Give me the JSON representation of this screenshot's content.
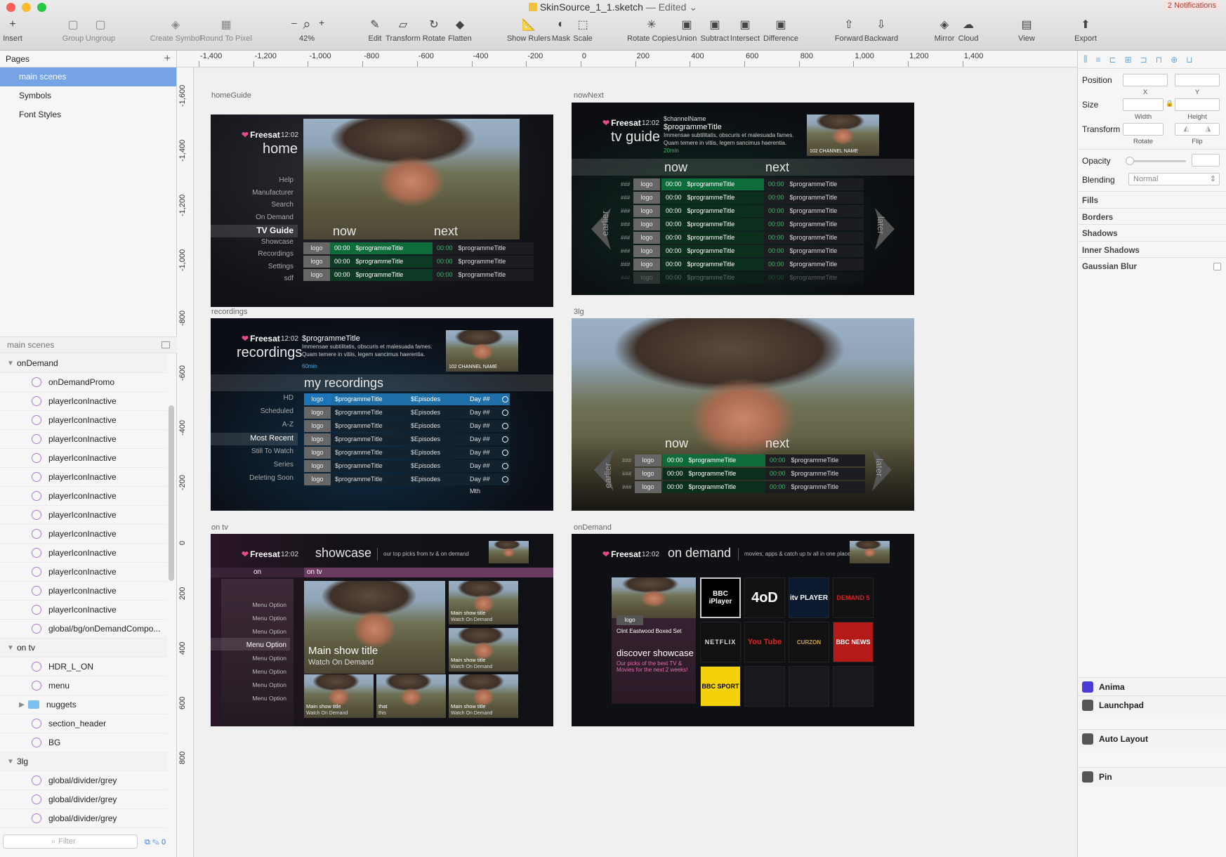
{
  "window": {
    "filename": "SkinSource_1_1.sketch",
    "status": "— Edited",
    "notifications": "2 Notifications"
  },
  "toolbar": [
    {
      "label": "Insert",
      "icon": "plus-icon"
    },
    {
      "label": "Group",
      "icon": "group-icon"
    },
    {
      "label": "Ungroup",
      "icon": "ungroup-icon"
    },
    {
      "label": "Create Symbol",
      "icon": "symbol-icon"
    },
    {
      "label": "Round To Pixel",
      "icon": "grid-icon"
    },
    {
      "label": "42%",
      "icon": "zoom-icon"
    },
    {
      "label": "Edit",
      "icon": "edit-icon"
    },
    {
      "label": "Transform",
      "icon": "transform-icon"
    },
    {
      "label": "Rotate",
      "icon": "rotate-icon"
    },
    {
      "label": "Flatten",
      "icon": "flatten-icon"
    },
    {
      "label": "Show Rulers",
      "icon": "ruler-icon"
    },
    {
      "label": "Mask",
      "icon": "mask-icon"
    },
    {
      "label": "Scale",
      "icon": "scale-icon"
    },
    {
      "label": "Rotate Copies",
      "icon": "rotate-copies-icon"
    },
    {
      "label": "Union",
      "icon": "union-icon"
    },
    {
      "label": "Subtract",
      "icon": "subtract-icon"
    },
    {
      "label": "Intersect",
      "icon": "intersect-icon"
    },
    {
      "label": "Difference",
      "icon": "difference-icon"
    },
    {
      "label": "Forward",
      "icon": "forward-icon"
    },
    {
      "label": "Backward",
      "icon": "backward-icon"
    },
    {
      "label": "Mirror",
      "icon": "mirror-icon"
    },
    {
      "label": "Cloud",
      "icon": "cloud-icon"
    },
    {
      "label": "View",
      "icon": "view-icon"
    },
    {
      "label": "Export",
      "icon": "export-icon"
    }
  ],
  "zoom_minus": "–",
  "zoom_plus": "+",
  "pages": {
    "title": "Pages",
    "items": [
      "main scenes",
      "Symbols",
      "Font Styles"
    ]
  },
  "layers": {
    "title": "main scenes",
    "groups": [
      {
        "name": "onDemand",
        "children": [
          "onDemandPromo",
          "playerIconInactive",
          "playerIconInactive",
          "playerIconInactive",
          "playerIconInactive",
          "playerIconInactive",
          "playerIconInactive",
          "playerIconInactive",
          "playerIconInactive",
          "playerIconInactive",
          "playerIconInactive",
          "playerIconInactive",
          "playerIconInactive",
          "global/bg/onDemandCompo..."
        ]
      },
      {
        "name": "on tv",
        "children": [
          "HDR_L_ON",
          "menu",
          "nuggets",
          "section_header",
          "BG"
        ]
      },
      {
        "name": "3lg",
        "children": [
          "global/divider/grey",
          "global/divider/grey",
          "global/divider/grey"
        ]
      }
    ],
    "filter_placeholder": "Filter",
    "filter_count": "0"
  },
  "rulers": {
    "h": [
      "-1,400",
      "-1,200",
      "-1,000",
      "-800",
      "-600",
      "-400",
      "-200",
      "0",
      "200",
      "400",
      "600",
      "800",
      "1,000",
      "1,200",
      "1,400"
    ],
    "v": [
      "-1,600",
      "-1,400",
      "-1,200",
      "-1,000",
      "-800",
      "-600",
      "-400",
      "-200",
      "0",
      "200",
      "400",
      "600",
      "800"
    ]
  },
  "artboards": {
    "homeGuide": {
      "label": "homeGuide",
      "brand": "Freesat",
      "time": "12:02",
      "title": "home",
      "menu": [
        "Help",
        "Manufacturer",
        "Search",
        "On Demand",
        "TV Guide",
        "Showcase",
        "Recordings",
        "Settings",
        "sdf"
      ],
      "now": "now",
      "next": "next",
      "rows": [
        {
          "logo": "logo",
          "time": "00:00",
          "title": "$programmeTitle",
          "ntime": "00:00",
          "ntitle": "$programmeTitle"
        },
        {
          "logo": "logo",
          "time": "00:00",
          "title": "$programmeTitle",
          "ntime": "00:00",
          "ntitle": "$programmeTitle"
        },
        {
          "logo": "logo",
          "time": "00:00",
          "title": "$programmeTitle",
          "ntime": "00:00",
          "ntitle": "$programmeTitle"
        }
      ]
    },
    "nowNext": {
      "label": "nowNext",
      "brand": "Freesat",
      "time": "12:02",
      "title": "tv guide",
      "channel": "$channelName",
      "programme": "$programmeTitle",
      "desc1": "Immensae subtilitatis, obscuris et malesuada fames.",
      "desc2": "Quam temere in vitiis, legem sancimus haerentia.",
      "duration": "20min",
      "thumb_caption": "102  CHANNEL NAME",
      "now": "now",
      "next": "next",
      "earlier": "earlier",
      "later": "later",
      "rows": [
        {
          "num": "###",
          "logo": "logo",
          "time": "00:00",
          "title": "$programmeTitle",
          "ntime": "00:00",
          "ntitle": "$programmeTitle"
        },
        {
          "num": "###",
          "logo": "logo",
          "time": "00:00",
          "title": "$programmeTitle",
          "ntime": "00:00",
          "ntitle": "$programmeTitle"
        },
        {
          "num": "###",
          "logo": "logo",
          "time": "00:00",
          "title": "$programmeTitle",
          "ntime": "00:00",
          "ntitle": "$programmeTitle"
        },
        {
          "num": "###",
          "logo": "logo",
          "time": "00:00",
          "title": "$programmeTitle",
          "ntime": "00:00",
          "ntitle": "$programmeTitle"
        },
        {
          "num": "###",
          "logo": "logo",
          "time": "00:00",
          "title": "$programmeTitle",
          "ntime": "00:00",
          "ntitle": "$programmeTitle"
        },
        {
          "num": "###",
          "logo": "logo",
          "time": "00:00",
          "title": "$programmeTitle",
          "ntime": "00:00",
          "ntitle": "$programmeTitle"
        },
        {
          "num": "###",
          "logo": "logo",
          "time": "00:00",
          "title": "$programmeTitle",
          "ntime": "00:00",
          "ntitle": "$programmeTitle"
        },
        {
          "num": "###",
          "logo": "logo",
          "time": "00:00",
          "title": "$programmeTitle",
          "ntime": "00:00",
          "ntitle": "$programmeTitle"
        }
      ]
    },
    "recordings": {
      "label": "recordings",
      "brand": "Freesat",
      "time": "12:02",
      "title": "recordings",
      "programme": "$programmeTitle",
      "desc1": "Immensae subtilitatis, obscuris et malesuada fames.",
      "desc2": "Quam temere in vitiis, legem sancimus haerentia.",
      "duration": "60min",
      "thumb_caption": "102  CHANNEL NAME",
      "section": "my recordings",
      "menu": [
        "HD",
        "Scheduled",
        "A-Z",
        "Most Recent",
        "Still To Watch",
        "Series",
        "Deleting Soon"
      ],
      "rows": [
        {
          "logo": "logo",
          "title": "$programmeTitle",
          "episodes": "$Episodes",
          "date": "Day ## Mth"
        },
        {
          "logo": "logo",
          "title": "$programmeTitle",
          "episodes": "$Episodes",
          "date": "Day ## Mth"
        },
        {
          "logo": "logo",
          "title": "$programmeTitle",
          "episodes": "$Episodes",
          "date": "Day ## Mth"
        },
        {
          "logo": "logo",
          "title": "$programmeTitle",
          "episodes": "$Episodes",
          "date": "Day ## Mth"
        },
        {
          "logo": "logo",
          "title": "$programmeTitle",
          "episodes": "$Episodes",
          "date": "Day ## Mth"
        },
        {
          "logo": "logo",
          "title": "$programmeTitle",
          "episodes": "$Episodes",
          "date": "Day ## Mth"
        },
        {
          "logo": "logo",
          "title": "$programmeTitle",
          "episodes": "$Episodes",
          "date": "Day ## Mth"
        }
      ]
    },
    "threeLg": {
      "label": "3lg",
      "now": "now",
      "next": "next",
      "earlier": "earlier",
      "later": "later",
      "rows": [
        {
          "num": "###",
          "logo": "logo",
          "time": "00:00",
          "title": "$programmeTitle",
          "ntime": "00:00",
          "ntitle": "$programmeTitle"
        },
        {
          "num": "###",
          "logo": "logo",
          "time": "00:00",
          "title": "$programmeTitle",
          "ntime": "00:00",
          "ntitle": "$programmeTitle"
        },
        {
          "num": "###",
          "logo": "logo",
          "time": "00:00",
          "title": "$programmeTitle",
          "ntime": "00:00",
          "ntitle": "$programmeTitle"
        }
      ]
    },
    "onTv": {
      "label": "on tv",
      "brand": "Freesat",
      "time": "12:02",
      "title": "showcase",
      "subtitle": "our top picks from tv & on demand",
      "tab_on": "on",
      "tab_ontv": "on tv",
      "menu": [
        "Menu Option",
        "Menu Option",
        "Menu Option",
        "Menu Option",
        "Menu Option",
        "Menu Option",
        "Menu Option",
        "Menu Option"
      ],
      "hero_title": "Main show title",
      "hero_sub": "Watch On Demand",
      "tiles": [
        {
          "t": "Main show title",
          "s": "Watch On Demand"
        },
        {
          "t": "Main show title",
          "s": "Watch On Demand"
        },
        {
          "t": "Main show title",
          "s": "Watch On Demand"
        },
        {
          "t": "that",
          "s": "this"
        },
        {
          "t": "Main show title",
          "s": "Watch On Demand"
        }
      ]
    },
    "onDemand": {
      "label": "onDemand",
      "brand": "Freesat",
      "time": "12:02",
      "title": "on demand",
      "subtitle": "movies, apps & catch up tv all in one place",
      "promo_logo": "logo",
      "promo_title": "Clint Eastwood Boxed Set",
      "discover": "discover showcase",
      "discover_sub": "Our picks of the best TV & Movies for the next 2 weeks!",
      "apps": [
        "BBC iPlayer",
        "4oD",
        "itv PLAYER",
        "DEMAND 5",
        "NETFLIX",
        "You Tube",
        "CURZON",
        "BBC NEWS",
        "BBC SPORT"
      ]
    }
  },
  "inspector": {
    "position": "Position",
    "x": "X",
    "y": "Y",
    "size": "Size",
    "width": "Width",
    "height": "Height",
    "transform": "Transform",
    "rotate": "Rotate",
    "flip": "Flip",
    "opacity": "Opacity",
    "blending": "Blending",
    "blend_value": "Normal",
    "sections": [
      "Fills",
      "Borders",
      "Shadows",
      "Inner Shadows",
      "Gaussian Blur"
    ],
    "plugins": [
      "Anima",
      "Launchpad",
      "Auto Layout",
      "Pin"
    ]
  },
  "colors": {
    "selection": "#75a3e4",
    "green": "#0e6b3a",
    "brand_pink": "#e64a8c",
    "accent_blue": "#2d7bd8"
  }
}
